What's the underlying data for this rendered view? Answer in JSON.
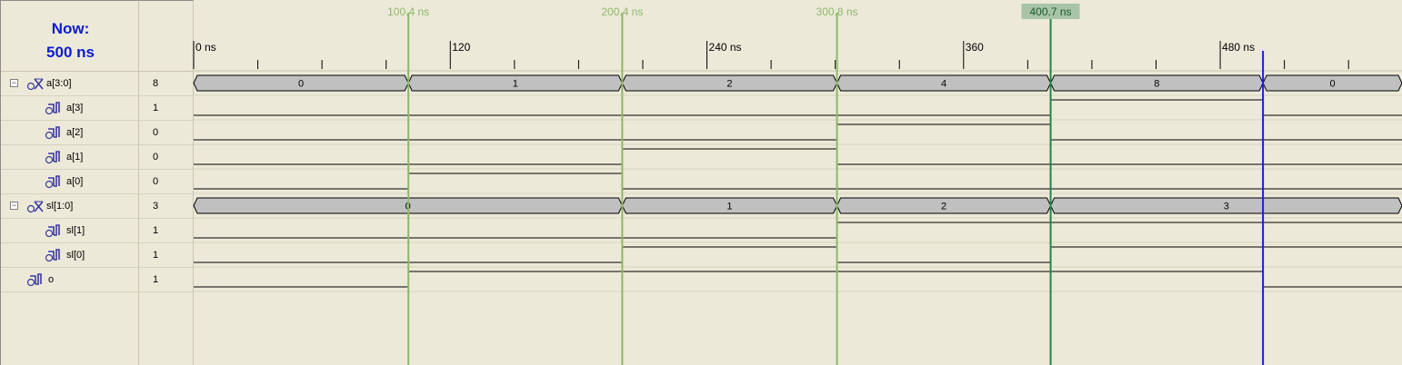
{
  "now": {
    "label": "Now:",
    "value": "500 ns"
  },
  "colors": {
    "background": "#ece9d8",
    "grid_line": "#d6d2c0",
    "waveform": "#000000",
    "bus_fill": "#c0c0c0",
    "marker_line": "#8fb86b",
    "marker_text": "#8fb86b",
    "active_marker": "#1a8a4a",
    "active_marker_bg": "#a8c4a8",
    "now_cursor": "#1520d8",
    "now_text": "#0b1bd0"
  },
  "timeline": {
    "start_ns": 0,
    "view_end_ns": 565,
    "ruler_labels": [
      {
        "t": 0,
        "text": "0 ns"
      },
      {
        "t": 120,
        "text": "120"
      },
      {
        "t": 240,
        "text": "240 ns"
      },
      {
        "t": 360,
        "text": "360"
      },
      {
        "t": 480,
        "text": "480 ns"
      }
    ],
    "minor_tick_step_ns": 30,
    "markers": [
      {
        "t": 100.4,
        "label": "100.4 ns",
        "active": false
      },
      {
        "t": 200.4,
        "label": "200.4 ns",
        "active": false
      },
      {
        "t": 300.8,
        "label": "300.8 ns",
        "active": false
      },
      {
        "t": 400.7,
        "label": "400.7 ns",
        "active": true
      }
    ],
    "cursor_ns": 500
  },
  "signals": [
    {
      "name": "a[3:0]",
      "value": "8",
      "kind": "bus",
      "expandable": true,
      "indent": 0,
      "segments": [
        {
          "from": 0,
          "to": 100.4,
          "text": "0"
        },
        {
          "from": 100.4,
          "to": 200.4,
          "text": "1"
        },
        {
          "from": 200.4,
          "to": 300.8,
          "text": "2"
        },
        {
          "from": 300.8,
          "to": 400.7,
          "text": "4"
        },
        {
          "from": 400.7,
          "to": 500,
          "text": "8"
        },
        {
          "from": 500,
          "to": 565,
          "text": "0"
        }
      ]
    },
    {
      "name": "a[3]",
      "value": "1",
      "kind": "bit",
      "expandable": false,
      "indent": 1,
      "transitions": [
        {
          "t": 0,
          "v": 0
        },
        {
          "t": 400.7,
          "v": 1
        },
        {
          "t": 500,
          "v": 0
        }
      ]
    },
    {
      "name": "a[2]",
      "value": "0",
      "kind": "bit",
      "expandable": false,
      "indent": 1,
      "transitions": [
        {
          "t": 0,
          "v": 0
        },
        {
          "t": 300.8,
          "v": 1
        },
        {
          "t": 400.7,
          "v": 0
        }
      ]
    },
    {
      "name": "a[1]",
      "value": "0",
      "kind": "bit",
      "expandable": false,
      "indent": 1,
      "transitions": [
        {
          "t": 0,
          "v": 0
        },
        {
          "t": 200.4,
          "v": 1
        },
        {
          "t": 300.8,
          "v": 0
        }
      ]
    },
    {
      "name": "a[0]",
      "value": "0",
      "kind": "bit",
      "expandable": false,
      "indent": 1,
      "transitions": [
        {
          "t": 0,
          "v": 0
        },
        {
          "t": 100.4,
          "v": 1
        },
        {
          "t": 200.4,
          "v": 0
        }
      ]
    },
    {
      "name": "sl[1:0]",
      "value": "3",
      "kind": "bus",
      "expandable": true,
      "indent": 0,
      "segments": [
        {
          "from": 0,
          "to": 200.4,
          "text": "0"
        },
        {
          "from": 200.4,
          "to": 300.8,
          "text": "1"
        },
        {
          "from": 300.8,
          "to": 400.7,
          "text": "2"
        },
        {
          "from": 400.7,
          "to": 565,
          "text": "3"
        }
      ]
    },
    {
      "name": "sl[1]",
      "value": "1",
      "kind": "bit",
      "expandable": false,
      "indent": 1,
      "transitions": [
        {
          "t": 0,
          "v": 0
        },
        {
          "t": 300.8,
          "v": 1
        }
      ]
    },
    {
      "name": "sl[0]",
      "value": "1",
      "kind": "bit",
      "expandable": false,
      "indent": 1,
      "transitions": [
        {
          "t": 0,
          "v": 0
        },
        {
          "t": 200.4,
          "v": 1
        },
        {
          "t": 300.8,
          "v": 0
        },
        {
          "t": 400.7,
          "v": 1
        }
      ]
    },
    {
      "name": "o",
      "value": "1",
      "kind": "bit",
      "expandable": false,
      "indent": 0,
      "transitions": [
        {
          "t": 0,
          "v": 0
        },
        {
          "t": 100.4,
          "v": 1
        },
        {
          "t": 500,
          "v": 0
        }
      ]
    }
  ]
}
